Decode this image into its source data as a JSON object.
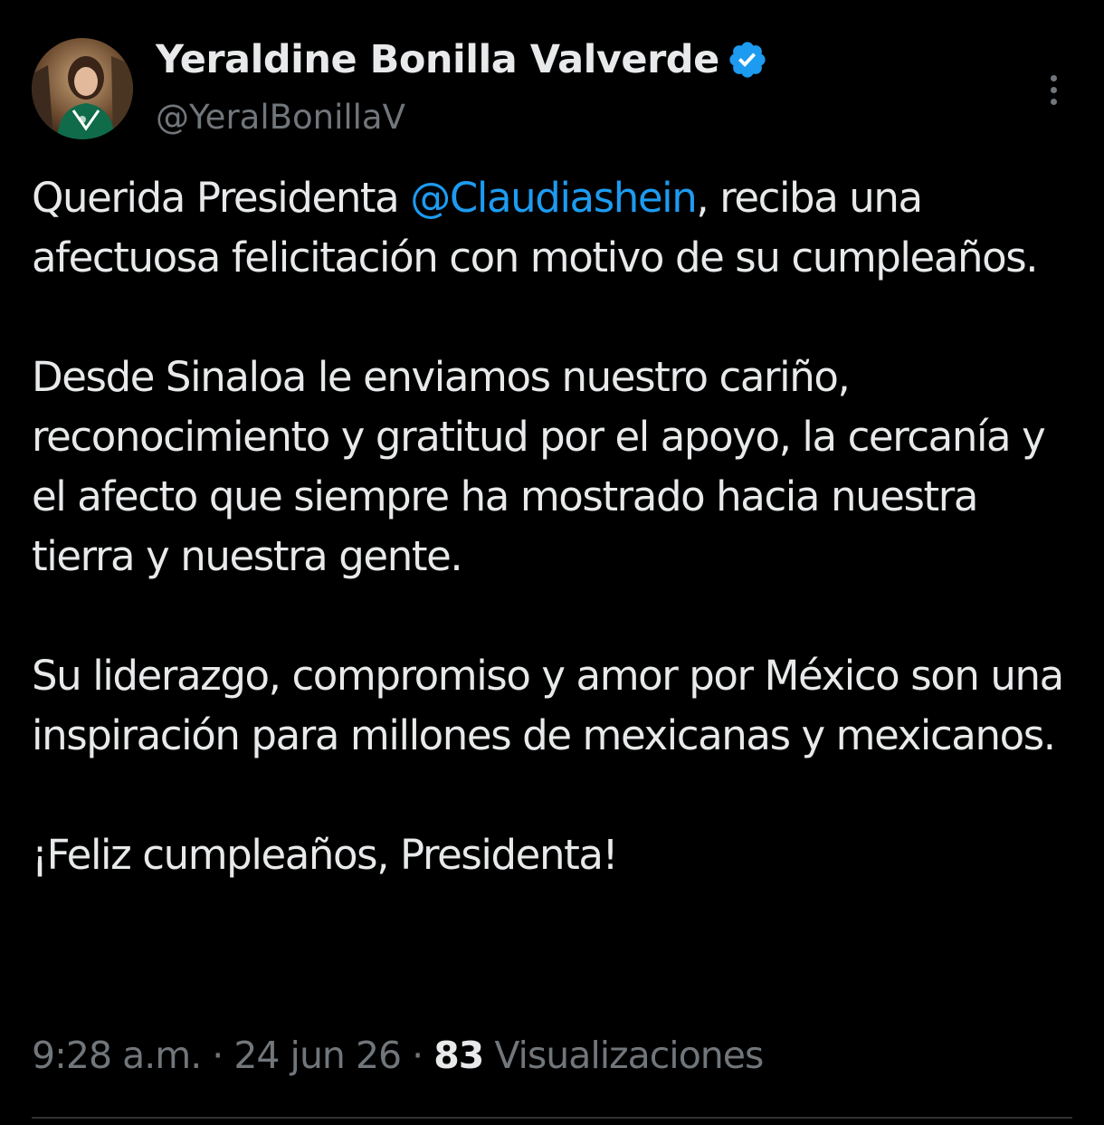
{
  "author": {
    "name": "Yeraldine Bonilla Valverde",
    "handle": "@YeralBonillaV",
    "verified": true
  },
  "tweet": {
    "p1_before": "Querida Presidenta ",
    "p1_mention": "@Claudiashein",
    "p1_after": ", reciba una afectuosa felicitación con motivo de su cumpleaños.",
    "p2": "Desde Sinaloa le enviamos nuestro cariño, reconocimiento y gratitud por el apoyo, la cercanía y el afecto que siempre ha mostrado hacia nuestra tierra y nuestra gente.",
    "p3": "Su liderazgo, compromiso y amor por México son una inspiración para millones de mexicanas y mexicanos.",
    "p4": "¡Feliz cumpleaños, Presidenta!"
  },
  "meta": {
    "time": "9:28 a.m.",
    "separator": " · ",
    "date": "24 jun 26",
    "views_count": "83",
    "views_label": " Visualizaciones"
  },
  "icons": {
    "verified": "verified-badge-icon",
    "more": "more-options-icon"
  },
  "colors": {
    "background": "#000000",
    "text": "#e7e9ea",
    "secondary": "#71767b",
    "accent": "#1d9bf0"
  }
}
